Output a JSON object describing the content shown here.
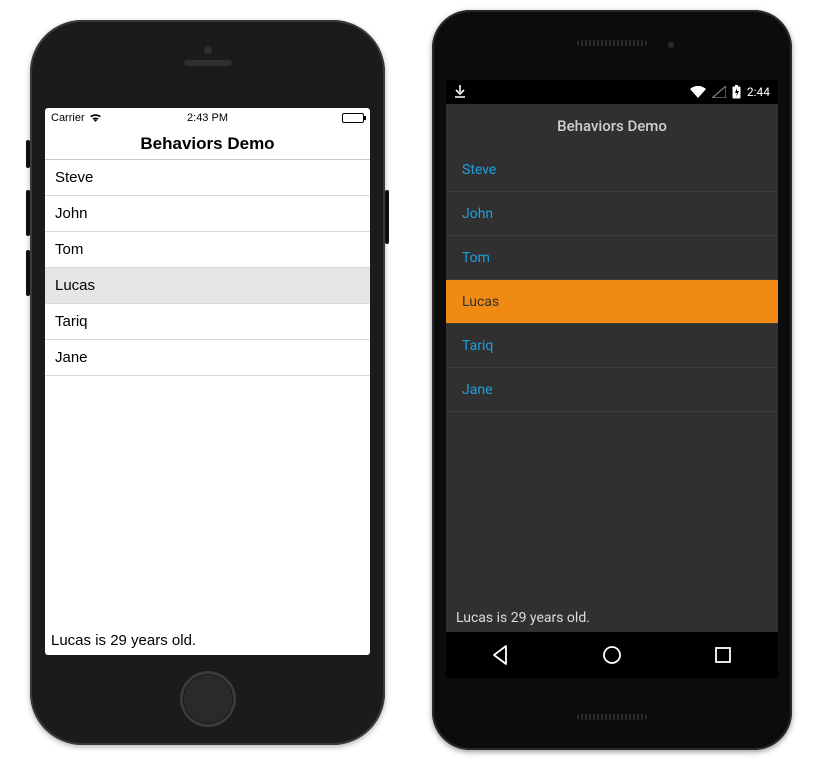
{
  "app_title": "Behaviors Demo",
  "people": [
    {
      "name": "Steve",
      "selected": false
    },
    {
      "name": "John",
      "selected": false
    },
    {
      "name": "Tom",
      "selected": false
    },
    {
      "name": "Lucas",
      "selected": true
    },
    {
      "name": "Tariq",
      "selected": false
    },
    {
      "name": "Jane",
      "selected": false
    }
  ],
  "detail_text": "Lucas is 29 years old.",
  "ios": {
    "carrier": "Carrier",
    "time": "2:43 PM"
  },
  "android": {
    "time": "2:44",
    "selection_color": "#f08a12",
    "accent_color": "#1e9fe0"
  }
}
